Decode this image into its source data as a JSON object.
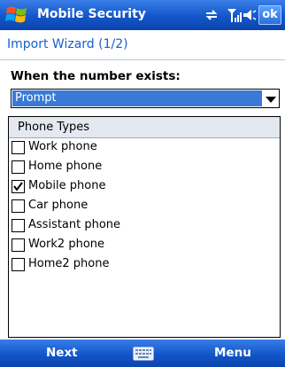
{
  "titlebar": {
    "app_title": "Mobile Security",
    "ok_label": "ok",
    "icons": [
      "windows-logo-icon",
      "sync-icon",
      "signal-icon",
      "volume-icon"
    ]
  },
  "header": {
    "title": "Import Wizard (1/2)"
  },
  "form": {
    "label": "When the number exists:",
    "dropdown_value": "Prompt"
  },
  "list": {
    "header": "Phone Types",
    "items": [
      {
        "label": "Work phone",
        "checked": false
      },
      {
        "label": "Home phone",
        "checked": false
      },
      {
        "label": "Mobile phone",
        "checked": true
      },
      {
        "label": "Car phone",
        "checked": false
      },
      {
        "label": "Assistant phone",
        "checked": false
      },
      {
        "label": "Work2 phone",
        "checked": false
      },
      {
        "label": "Home2 phone",
        "checked": false
      }
    ]
  },
  "softkeys": {
    "left": "Next",
    "right": "Menu",
    "center_icon": "keyboard-icon"
  },
  "colors": {
    "bar": "#1256c9",
    "accent_text": "#1560c8",
    "selection": "#3b79d6"
  }
}
